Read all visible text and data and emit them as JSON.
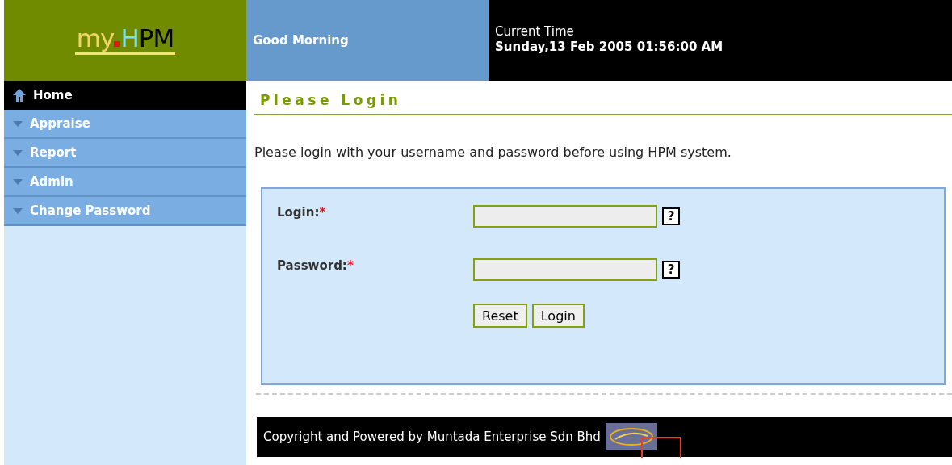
{
  "logo": {
    "parts": [
      {
        "text": "my",
        "color": "#f5d36a"
      },
      {
        "text": "H",
        "color": "#7fdfe8"
      },
      {
        "text": "PM",
        "color": "#000000"
      }
    ],
    "dot": {
      "color": "#ee1111"
    }
  },
  "greeting": "Good Morning",
  "clock": {
    "label": "Current Time",
    "value": "Sunday,13 Feb 2005 01:56:00 AM"
  },
  "sidebar": {
    "items": [
      {
        "label": "Home",
        "kind": "home",
        "selected": true
      },
      {
        "label": "Appraise",
        "kind": "menu",
        "selected": false
      },
      {
        "label": "Report",
        "kind": "menu",
        "selected": false
      },
      {
        "label": "Admin",
        "kind": "menu",
        "selected": false
      },
      {
        "label": "Change Password",
        "kind": "menu",
        "selected": false
      }
    ]
  },
  "heading": "Please Login",
  "intro": "Please login with your username and password before using HPM system.",
  "form": {
    "fields": [
      {
        "label": "Login:",
        "required_mark": "*",
        "help": "?"
      },
      {
        "label": "Password:",
        "required_mark": "*",
        "help": "?"
      }
    ],
    "buttons": [
      "Reset",
      "Login"
    ]
  },
  "footer": {
    "text": "Copyright and Powered by Muntada Enterprise Sdn Bhd"
  }
}
